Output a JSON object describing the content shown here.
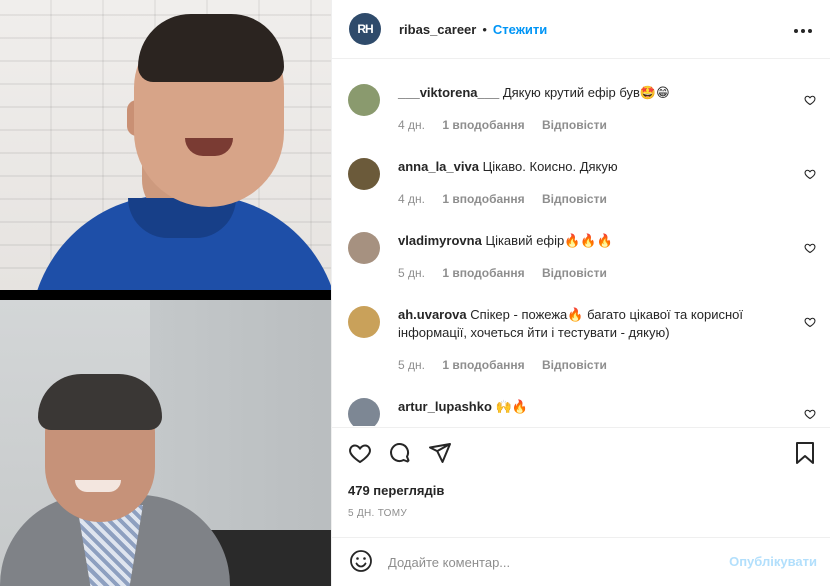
{
  "header": {
    "logo_text": "RH",
    "username": "ribas_career",
    "separator": "•",
    "follow_label": "Стежити",
    "more_label": "•••"
  },
  "comments": [
    {
      "username": "___viktorena___",
      "text": "Дякую крутий ефір був🤩😁",
      "age": "4 дн.",
      "likes": "1 вподобання",
      "reply_label": "Відповісти",
      "avatar_color": "#8a9a6e"
    },
    {
      "username": "anna_la_viva",
      "text": "Цікаво. Коисно. Дякую",
      "age": "4 дн.",
      "likes": "1 вподобання",
      "reply_label": "Відповісти",
      "avatar_color": "#6b5a3a"
    },
    {
      "username": "vladimyrovna",
      "text": "Цікавий ефір🔥🔥🔥",
      "age": "5 дн.",
      "likes": "1 вподобання",
      "reply_label": "Відповісти",
      "avatar_color": "#a69180"
    },
    {
      "username": "ah.uvarova",
      "text": "Спікер - пожежа🔥 багато цікавої та корисної інформації, хочеться йти і тестувати - дякую)",
      "age": "5 дн.",
      "likes": "1 вподобання",
      "reply_label": "Відповісти",
      "avatar_color": "#c9a15a"
    },
    {
      "username": "artur_lupashko",
      "text": "🙌🔥",
      "avatar_color": "#7d8794"
    }
  ],
  "stats": {
    "views": "479 переглядів",
    "time_ago": "5 ДН. ТОМУ"
  },
  "comment_box": {
    "placeholder": "Додайте коментар...",
    "publish_label": "Опублікувати"
  },
  "colors": {
    "accent": "#0095f6",
    "publish_disabled": "#b2dffc",
    "muted": "#8e8e8e"
  }
}
